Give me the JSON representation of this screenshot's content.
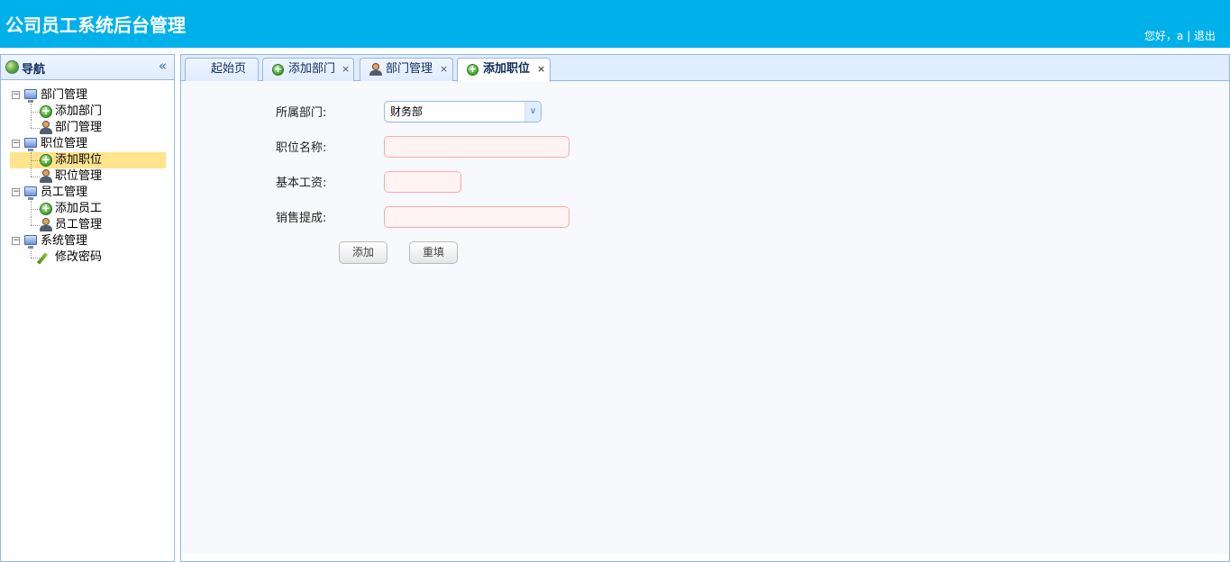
{
  "header": {
    "title": "公司员工系统后台管理",
    "greeting": "您好，a",
    "separator": "|",
    "logout": "退出",
    "bg_color": "#00b0ea"
  },
  "west": {
    "title": "导航",
    "collapse_icon": "«",
    "tree": [
      {
        "label": "部门管理",
        "children": [
          {
            "label": "添加部门",
            "icon": "add-icon"
          },
          {
            "label": "部门管理",
            "icon": "user-icon"
          }
        ]
      },
      {
        "label": "职位管理",
        "children": [
          {
            "label": "添加职位",
            "icon": "add-icon",
            "selected": true
          },
          {
            "label": "职位管理",
            "icon": "user-icon"
          }
        ]
      },
      {
        "label": "员工管理",
        "children": [
          {
            "label": "添加员工",
            "icon": "add-icon"
          },
          {
            "label": "员工管理",
            "icon": "user-icon"
          }
        ]
      },
      {
        "label": "系统管理",
        "children": [
          {
            "label": "修改密码",
            "icon": "pencil-icon"
          }
        ]
      }
    ],
    "selected_color": "#ffe48d"
  },
  "tabs": [
    {
      "label": "起始页",
      "closable": false
    },
    {
      "label": "添加部门",
      "closable": true,
      "icon": "add-icon"
    },
    {
      "label": "部门管理",
      "closable": true,
      "icon": "user-icon"
    },
    {
      "label": "添加职位",
      "closable": true,
      "icon": "add-icon",
      "active": true
    }
  ],
  "tab_close": "×",
  "form": {
    "dept_label": "所属部门:",
    "dept_value": "财务部",
    "position_label": "职位名称:",
    "salary_label": "基本工资:",
    "commission_label": "销售提成:",
    "submit": "添加",
    "reset": "重填"
  }
}
